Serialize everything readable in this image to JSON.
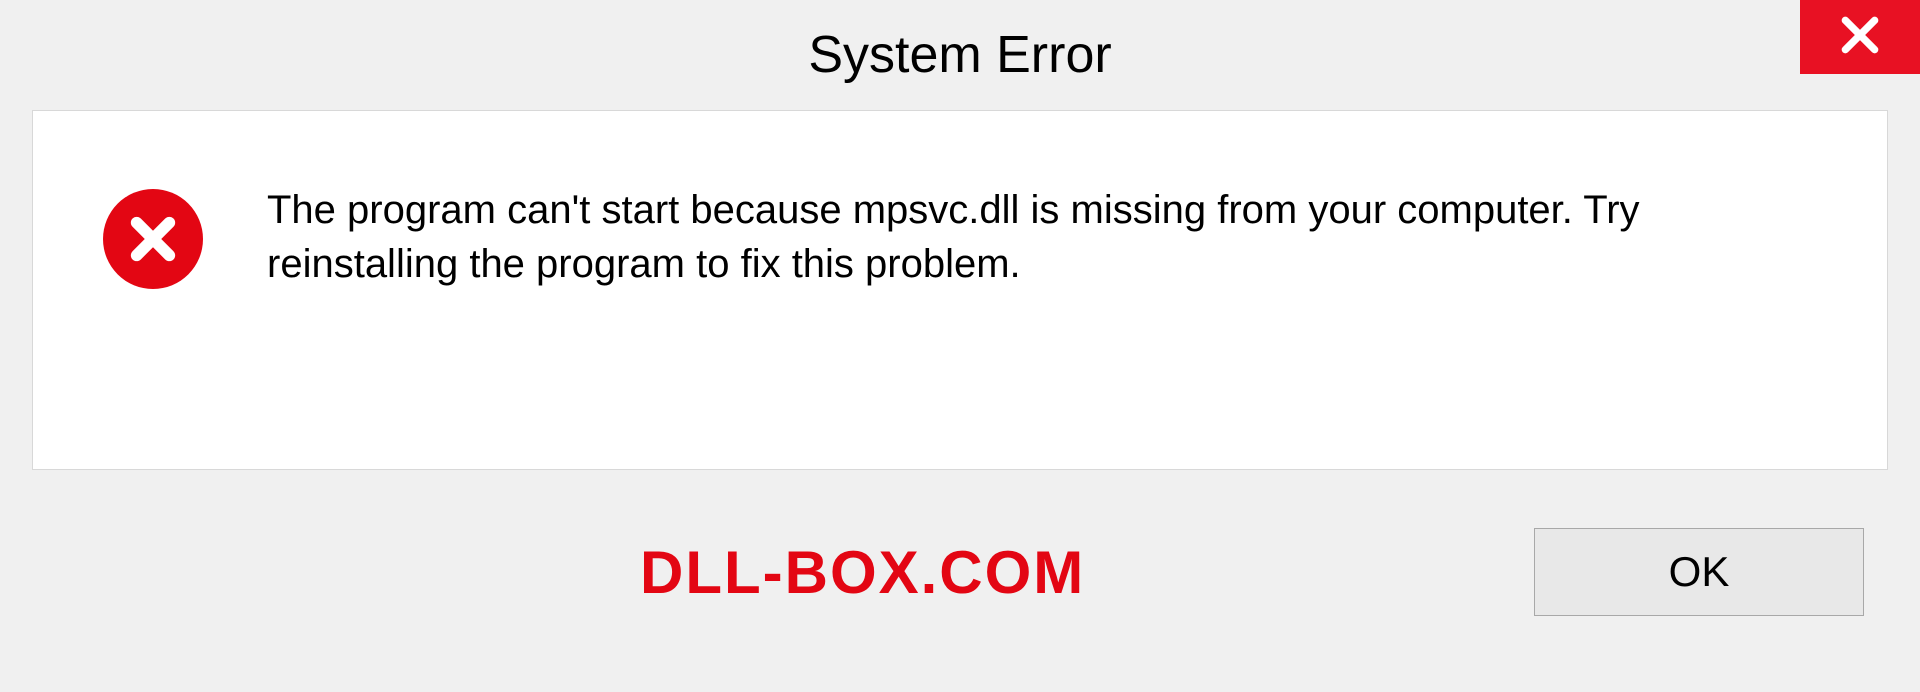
{
  "dialog": {
    "title": "System Error",
    "message": "The program can't start because mpsvc.dll is missing from your computer. Try reinstalling the program to fix this problem.",
    "ok_label": "OK"
  },
  "watermark": "DLL-BOX.COM"
}
